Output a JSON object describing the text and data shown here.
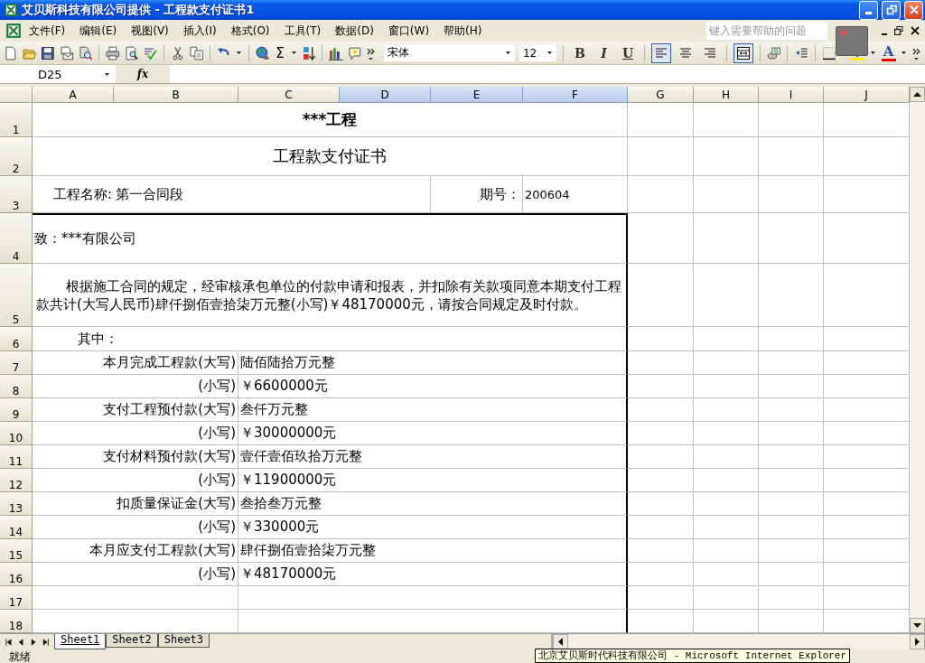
{
  "window": {
    "title": "艾贝斯科技有限公司提供 - 工程款支付证书1"
  },
  "menu": [
    {
      "label": "文件(F)"
    },
    {
      "label": "编辑(E)"
    },
    {
      "label": "视图(V)"
    },
    {
      "label": "插入(I)"
    },
    {
      "label": "格式(O)"
    },
    {
      "label": "工具(T)"
    },
    {
      "label": "数据(D)"
    },
    {
      "label": "窗口(W)"
    },
    {
      "label": "帮助(H)"
    }
  ],
  "help_box": {
    "placeholder": "键入需要帮助的问题"
  },
  "toolbar": {
    "sum_label": "Σ",
    "font": "宋体",
    "size": "12",
    "format_buttons": [
      {
        "label": "B",
        "kind": "bold"
      },
      {
        "label": "I",
        "kind": "italic"
      },
      {
        "label": "U",
        "kind": "underline"
      }
    ],
    "align": [
      {
        "kind": "left",
        "pressed": true
      },
      {
        "kind": "center",
        "pressed": false
      },
      {
        "kind": "right",
        "pressed": false
      },
      {
        "kind": "merge",
        "pressed": true
      }
    ],
    "font_color_label": "A"
  },
  "formula_bar": {
    "name_box": "D25",
    "function_label": "fx"
  },
  "columns": [
    {
      "label": "A",
      "selected": false
    },
    {
      "label": "B",
      "selected": false
    },
    {
      "label": "C",
      "selected": false
    },
    {
      "label": "D",
      "selected": true
    },
    {
      "label": "E",
      "selected": true
    },
    {
      "label": "F",
      "selected": true
    },
    {
      "label": "G",
      "selected": false
    },
    {
      "label": "H",
      "selected": false
    },
    {
      "label": "I",
      "selected": false
    },
    {
      "label": "J",
      "selected": false
    }
  ],
  "rows": [
    {
      "number": "1",
      "kind": "title",
      "text": "***工程"
    },
    {
      "number": "2",
      "kind": "subtitle",
      "text": "工程款支付证书"
    },
    {
      "number": "3",
      "kind": "field",
      "name_label": "工程名称:",
      "name_value": "第一合同段",
      "period_label": "期号：",
      "period_value": "200604"
    },
    {
      "number": "4",
      "kind": "recipient",
      "text": "致：***有限公司"
    },
    {
      "number": "5",
      "kind": "paragraph",
      "text": "根据施工合同的规定，经审核承包单位的付款申请和报表，并扣除有关款项同意本期支付工程款共计(大写人民币)肆仟捌佰壹拾柒万元整(小写)￥48170000元，请按合同规定及时付款。"
    },
    {
      "number": "6",
      "kind": "note",
      "text": "其中："
    },
    {
      "number": "7",
      "kind": "amount",
      "label": "本月完成工程款(大写)",
      "value": "陆佰陆拾万元整"
    },
    {
      "number": "8",
      "kind": "amount",
      "label": "(小写)",
      "value": "￥6600000元"
    },
    {
      "number": "9",
      "kind": "amount",
      "label": "支付工程预付款(大写)",
      "value": "叁仟万元整"
    },
    {
      "number": "10",
      "kind": "amount",
      "label": "(小写)",
      "value": "￥30000000元"
    },
    {
      "number": "11",
      "kind": "amount",
      "label": "支付材料预付款(大写)",
      "value": "壹仟壹佰玖拾万元整"
    },
    {
      "number": "12",
      "kind": "amount",
      "label": "(小写)",
      "value": "￥11900000元"
    },
    {
      "number": "13",
      "kind": "amount",
      "label": "扣质量保证金(大写)",
      "value": "叁拾叁万元整"
    },
    {
      "number": "14",
      "kind": "amount",
      "label": "(小写)",
      "value": "￥330000元"
    },
    {
      "number": "15",
      "kind": "amount",
      "label": "本月应支付工程款(大写)",
      "value": "肆仟捌佰壹拾柒万元整"
    },
    {
      "number": "16",
      "kind": "amount",
      "label": "(小写)",
      "value": "￥48170000元"
    },
    {
      "number": "17",
      "kind": "empty"
    },
    {
      "number": "18",
      "kind": "empty"
    }
  ],
  "sheet_tabs": [
    {
      "label": "Sheet1",
      "selected": true
    },
    {
      "label": "Sheet2",
      "selected": false
    },
    {
      "label": "Sheet3",
      "selected": false
    }
  ],
  "status_bar": {
    "text": "就绪"
  },
  "tooltip": {
    "text": "北京艾贝斯时代科技有限公司 - Microsoft Internet Explorer"
  }
}
